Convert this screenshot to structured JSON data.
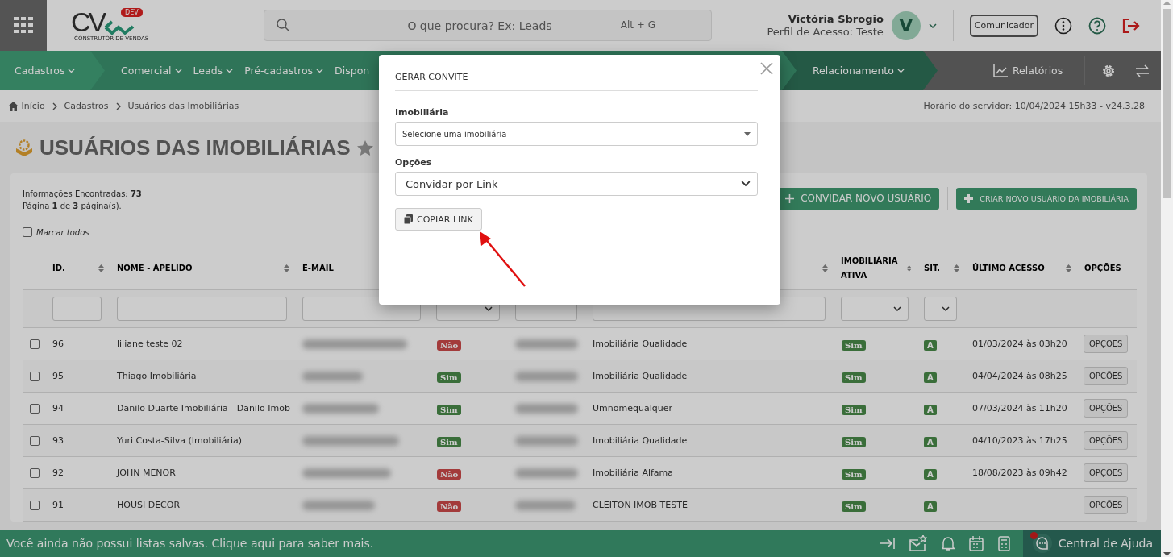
{
  "header": {
    "logo": {
      "letters": "CV",
      "badge": "DEV",
      "tagline": "CONSTRUTOR DE VENDAS"
    },
    "search": {
      "placeholder": "O que procura? Ex: Leads",
      "shortcut": "Alt + G"
    },
    "user": {
      "name": "Victória Sbrogio",
      "profile": "Perfil de Acesso: Teste",
      "initial": "V"
    },
    "communicator": "Comunicador"
  },
  "nav": {
    "items": [
      {
        "label": "Cadastros",
        "selected": true
      },
      {
        "label": "Comercial",
        "selected": false
      },
      {
        "label": "Leads",
        "selected": false
      },
      {
        "label": "Pré-cadastros",
        "selected": false
      },
      {
        "label": "Dispon",
        "selected": false
      },
      {
        "label": "Relacionamento",
        "selected": false,
        "kind": "module"
      }
    ],
    "reports": "Relatórios"
  },
  "breadcrumb": [
    "Início",
    "Cadastros",
    "Usuários das Imobiliárias"
  ],
  "server_time": "Horário do servidor: 10/04/2024 15h33 - v24.3.28",
  "page_title": "USUÁRIOS DAS IMOBILIÁRIAS",
  "favorite": false,
  "summary": [
    "Informações Encontradas: **73**",
    "Página **1** de **3** página(s)."
  ],
  "select_all": {
    "label": "Marcar todos",
    "checked": false
  },
  "actions": [
    "CONVIDAR NOVO USUÁRIO",
    "CRIAR NOVO USUÁRIO DA IMOBILIÁRIA"
  ],
  "table": {
    "columns": [
      {
        "label": "ID.",
        "sortable": true
      },
      {
        "label": "NOME - APELIDO",
        "sortable": true
      },
      {
        "label": "E-MAIL",
        "sortable": false
      },
      {},
      {},
      {
        "sortable": true
      },
      {
        "label": "IMOBILIÁRIA ATIVA",
        "sortable": true
      },
      {
        "label": "SIT.",
        "sortable": true
      },
      {
        "label": "ÚLTIMO ACESSO",
        "sortable": true
      },
      {
        "label": "OPÇÕES",
        "sortable": false
      }
    ],
    "filters": [
      {
        "kind": "input"
      },
      {
        "kind": "input"
      },
      {
        "kind": "input"
      },
      {
        "kind": "select"
      },
      {
        "kind": "input"
      },
      {
        "kind": "input"
      },
      {
        "kind": "select"
      },
      {
        "kind": "select"
      },
      {
        "kind": "none"
      },
      {
        "kind": "none"
      }
    ],
    "rows": [
      {
        "checked": false,
        "cells": [
          {
            "kind": "text",
            "text": "96"
          },
          {
            "kind": "text",
            "text": "liliane teste 02"
          },
          {
            "kind": "redacted"
          },
          {
            "kind": "badge",
            "text": "Não",
            "positive": false
          },
          {
            "kind": "redacted"
          },
          {
            "kind": "text",
            "text": "Imobiliária Qualidade"
          },
          {
            "kind": "badge",
            "text": "Sim",
            "positive": true
          },
          {
            "kind": "status",
            "text": "A"
          },
          {
            "kind": "text",
            "text": "01/03/2024 às 03h20"
          },
          {
            "kind": "button",
            "text": "OPÇÕES"
          }
        ]
      },
      {
        "checked": false,
        "cells": [
          {
            "kind": "text",
            "text": "95"
          },
          {
            "kind": "text",
            "text": "Thiago Imobiliária"
          },
          {
            "kind": "redacted"
          },
          {
            "kind": "badge",
            "text": "Sim",
            "positive": true
          },
          {
            "kind": "redacted"
          },
          {
            "kind": "text",
            "text": "Imobiliária Qualidade"
          },
          {
            "kind": "badge",
            "text": "Sim",
            "positive": true
          },
          {
            "kind": "status",
            "text": "A"
          },
          {
            "kind": "text",
            "text": "04/04/2024 às 08h25"
          },
          {
            "kind": "button",
            "text": "OPÇÕES"
          }
        ]
      },
      {
        "checked": false,
        "cells": [
          {
            "kind": "text",
            "text": "94"
          },
          {
            "kind": "text",
            "text": "Danilo Duarte Imobiliária - Danilo Imob"
          },
          {
            "kind": "redacted"
          },
          {
            "kind": "badge",
            "text": "Sim",
            "positive": true
          },
          {
            "kind": "redacted"
          },
          {
            "kind": "text",
            "text": "Umnomequalquer"
          },
          {
            "kind": "badge",
            "text": "Sim",
            "positive": true
          },
          {
            "kind": "status",
            "text": "A"
          },
          {
            "kind": "text",
            "text": "07/03/2024 às 11h20"
          },
          {
            "kind": "button",
            "text": "OPÇÕES"
          }
        ]
      },
      {
        "checked": false,
        "cells": [
          {
            "kind": "text",
            "text": "93"
          },
          {
            "kind": "text",
            "text": "Yuri Costa-Silva (Imobiliária)"
          },
          {
            "kind": "redacted"
          },
          {
            "kind": "badge",
            "text": "Sim",
            "positive": true
          },
          {
            "kind": "redacted"
          },
          {
            "kind": "text",
            "text": "Imobiliária Qualidade"
          },
          {
            "kind": "badge",
            "text": "Sim",
            "positive": true
          },
          {
            "kind": "status",
            "text": "A"
          },
          {
            "kind": "text",
            "text": "04/10/2023 às 17h25"
          },
          {
            "kind": "button",
            "text": "OPÇÕES"
          }
        ]
      },
      {
        "checked": false,
        "cells": [
          {
            "kind": "text",
            "text": "92"
          },
          {
            "kind": "text",
            "text": "JOHN MENOR"
          },
          {
            "kind": "redacted"
          },
          {
            "kind": "badge",
            "text": "Não",
            "positive": false
          },
          {
            "kind": "redacted"
          },
          {
            "kind": "text",
            "text": "Imobiliária Alfama"
          },
          {
            "kind": "badge",
            "text": "Sim",
            "positive": true
          },
          {
            "kind": "status",
            "text": "A"
          },
          {
            "kind": "text",
            "text": "18/08/2023 às 09h42"
          },
          {
            "kind": "button",
            "text": "OPÇÕES"
          }
        ]
      },
      {
        "checked": false,
        "cells": [
          {
            "kind": "text",
            "text": "91"
          },
          {
            "kind": "text",
            "text": "HOUSI DECOR"
          },
          {
            "kind": "redacted"
          },
          {
            "kind": "badge",
            "text": "Não",
            "positive": false
          },
          {
            "kind": "redacted"
          },
          {
            "kind": "text",
            "text": "CLEITON IMOB TESTE"
          },
          {
            "kind": "badge",
            "text": "Sim",
            "positive": true
          },
          {
            "kind": "status",
            "text": "A"
          },
          {
            "kind": "empty"
          },
          {
            "kind": "button",
            "text": "OPÇÕES"
          }
        ]
      }
    ]
  },
  "status_bar": {
    "message": "Você ainda não possui listas salvas. Clique aqui para saber mais.",
    "help": "Central de Ajuda",
    "help_notification": true
  },
  "modal": {
    "title": "GERAR CONVITE",
    "fields": [
      {
        "label": "Imobiliária",
        "value": "Selecione uma imobiliária",
        "kind": "compact"
      },
      {
        "label": "Opções",
        "value": "Convidar por Link",
        "kind": "standard"
      }
    ],
    "button": "COPIAR LINK"
  }
}
